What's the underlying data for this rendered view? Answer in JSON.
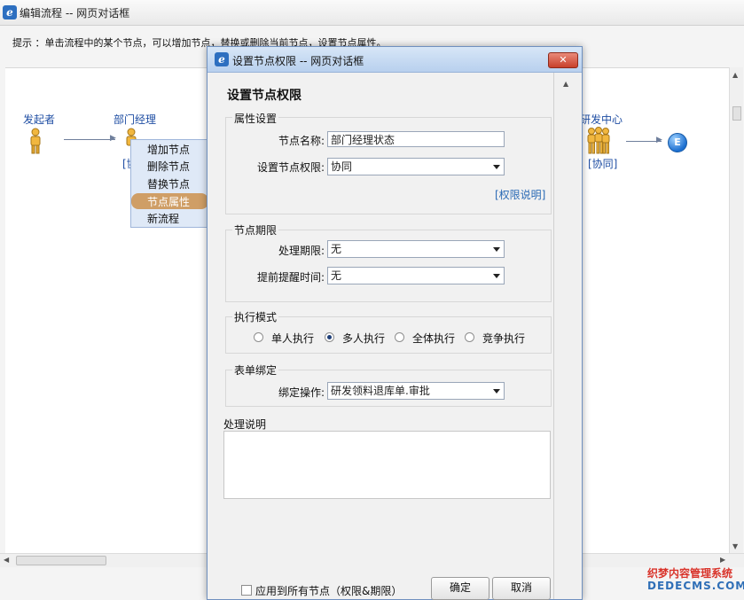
{
  "outer_window": {
    "title": "编辑流程 -- 网页对话框",
    "hint": "提示 ：单击流程中的某个节点，可以增加节点，替换或删除当前节点，设置节点属性。"
  },
  "flow": {
    "nodes": {
      "starter": "发起者",
      "dept_manager": "部门经理",
      "dept_manager_tag": "[协",
      "rd_center": "研发中心",
      "rd_center_tag": "[协同]",
      "end": "E"
    }
  },
  "context_menu": {
    "items": [
      "增加节点",
      "删除节点",
      "替换节点",
      "节点属性",
      "新流程"
    ],
    "active_index": 3
  },
  "dialog": {
    "title": "设置节点权限 -- 网页对话框",
    "close": "✕",
    "heading": "设置节点权限",
    "attr_section": {
      "legend": "属性设置",
      "node_name_label": "节点名称:",
      "node_name_value": "部门经理状态",
      "permission_label": "设置节点权限:",
      "permission_value": "协同",
      "permission_link": "[权限说明]"
    },
    "deadline_section": {
      "legend": "节点期限",
      "process_label": "处理期限:",
      "process_value": "无",
      "reminder_label": "提前提醒时间:",
      "reminder_value": "无"
    },
    "mode_section": {
      "legend": "执行模式",
      "options": [
        "单人执行",
        "多人执行",
        "全体执行",
        "竞争执行"
      ],
      "selected_index": 1
    },
    "form_section": {
      "legend": "表单绑定",
      "bind_label": "绑定操作:",
      "bind_value": "研发领料退库单.审批"
    },
    "notes_label": "处理说明",
    "apply_all_label": "应用到所有节点（权限&期限）",
    "ok": "确定",
    "cancel": "取消"
  },
  "watermark": {
    "line1": "织梦内容管理系统",
    "line2": "DEDECMS.COM"
  },
  "icons": {
    "browser": "ie-icon",
    "person": "person-icon",
    "group": "group-icon"
  },
  "colors": {
    "menu_active": "#cf9e66",
    "link": "#2a6ab5",
    "node_label": "#1f4ea3"
  }
}
